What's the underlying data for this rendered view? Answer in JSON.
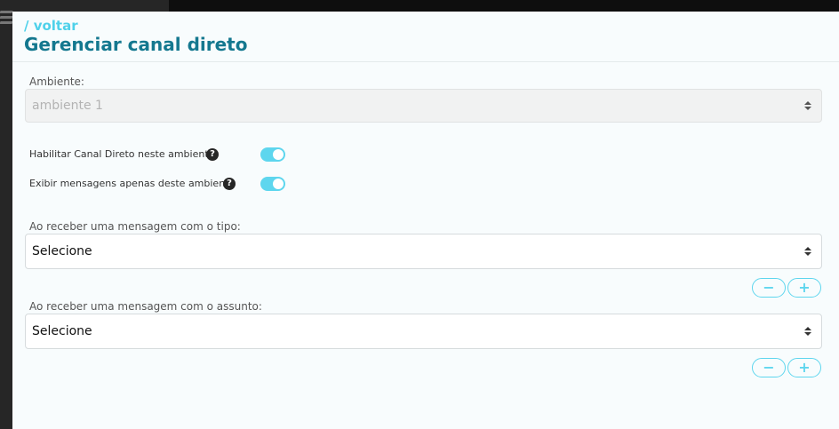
{
  "header": {
    "back_label": "/ voltar",
    "title": "Gerenciar canal direto"
  },
  "ambiente": {
    "label": "Ambiente:",
    "value": "ambiente 1",
    "disabled": true
  },
  "toggles": [
    {
      "label": "Habilitar Canal Direto neste ambiente",
      "help_icon": "?",
      "enabled": true
    },
    {
      "label": "Exibir mensagens apenas deste ambiente",
      "help_icon": "?",
      "enabled": true
    }
  ],
  "tipo": {
    "label": "Ao receber uma mensagem com o tipo:",
    "value": "Selecione"
  },
  "assunto": {
    "label": "Ao receber uma mensagem com o assunto:",
    "value": "Selecione"
  },
  "buttons": {
    "minus": "−",
    "plus": "+"
  },
  "colors": {
    "accent": "#5ed6ee",
    "title": "#14788f",
    "back_link": "#4fd1ea"
  }
}
